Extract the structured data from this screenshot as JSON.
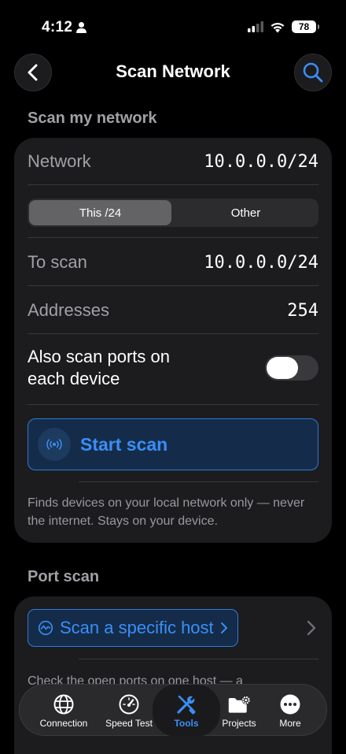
{
  "status_bar": {
    "time": "4:12",
    "battery": "78"
  },
  "nav": {
    "title": "Scan Network"
  },
  "scan_section": {
    "header": "Scan my network",
    "network_label": "Network",
    "network_value": "10.0.0.0/24",
    "segments": [
      "This /24",
      "Other"
    ],
    "selected_segment": "This /24",
    "to_scan_label": "To scan",
    "to_scan_value": "10.0.0.0/24",
    "addresses_label": "Addresses",
    "addresses_value": "254",
    "ports_toggle_label": "Also scan ports on each device",
    "ports_toggle_on": false,
    "start_button": "Start scan",
    "footnote": "Finds devices on your local network only — never the internet. Stays on your device."
  },
  "port_section": {
    "header": "Port scan",
    "host_button": "Scan a specific host",
    "description": "Check the open ports on one host — a"
  },
  "tabbar": {
    "items": [
      {
        "label": "Connection",
        "icon": "globe-icon"
      },
      {
        "label": "Speed Test",
        "icon": "speedometer-icon"
      },
      {
        "label": "Tools",
        "icon": "tools-icon"
      },
      {
        "label": "Projects",
        "icon": "folder-gear-icon"
      },
      {
        "label": "More",
        "icon": "ellipsis-icon"
      }
    ],
    "active": "Tools"
  },
  "colors": {
    "accent": "#3a8ef6",
    "card": "#1c1c1e",
    "background": "#000000"
  }
}
